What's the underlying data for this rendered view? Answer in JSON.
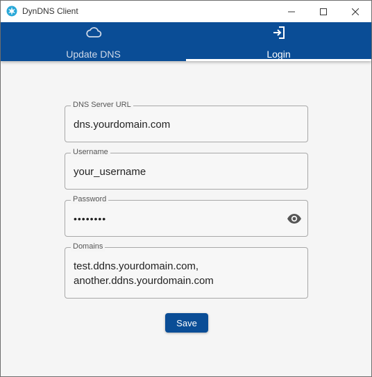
{
  "window": {
    "title": "DynDNS Client",
    "controls": [
      "minimize-icon",
      "maximize-icon",
      "close-icon"
    ]
  },
  "tabs": [
    {
      "label": "Update DNS",
      "icon": "cloud-icon",
      "selected": false
    },
    {
      "label": "Login",
      "icon": "login-icon",
      "selected": true
    }
  ],
  "form": {
    "dns_server_url": {
      "label": "DNS Server URL",
      "value": "dns.yourdomain.com"
    },
    "username": {
      "label": "Username",
      "value": "your_username"
    },
    "password": {
      "label": "Password",
      "value": "••••••••",
      "icon": "eye-icon"
    },
    "domains": {
      "label": "Domains",
      "value_line1": "test.ddns.yourdomain.com,",
      "value_line2": "another.ddns.yourdomain.com"
    },
    "save_label": "Save"
  },
  "colors": {
    "accent": "#0a4d96",
    "background": "#f5f5f5"
  }
}
